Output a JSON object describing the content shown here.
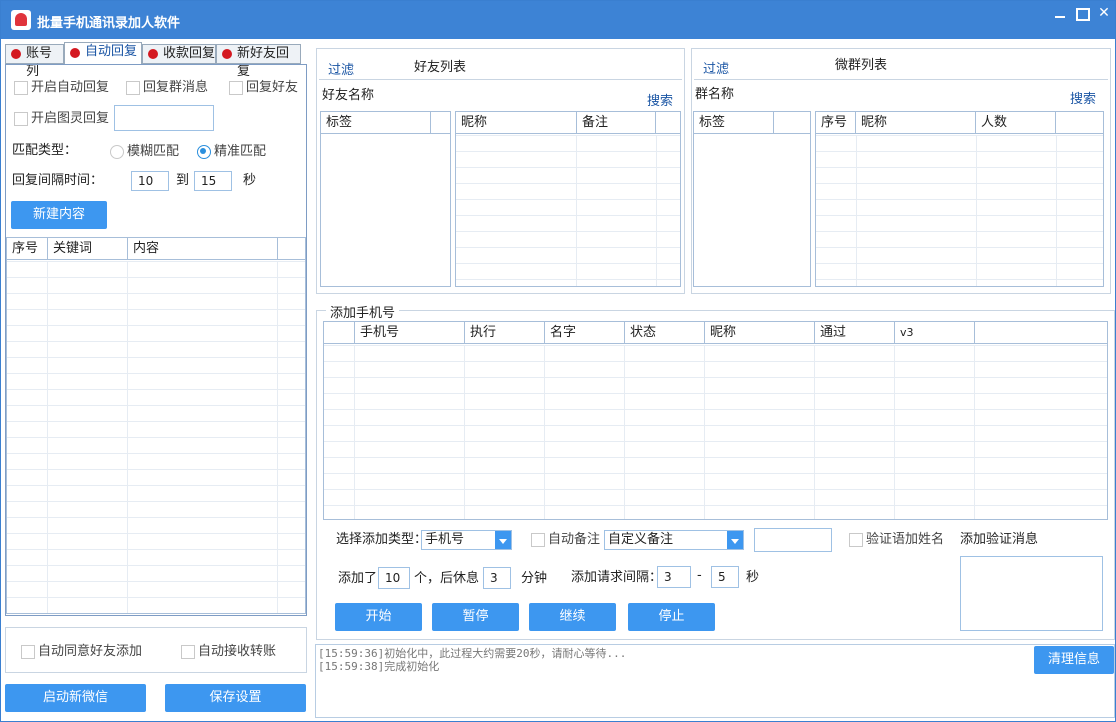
{
  "window": {
    "title": "批量手机通讯录加人软件"
  },
  "tabs": [
    {
      "label": "账号列"
    },
    {
      "label": "自动回复"
    },
    {
      "label": "收款回复"
    },
    {
      "label": "新好友回复"
    }
  ],
  "auto_reply": {
    "enable_auto_reply": "开启自动回复",
    "reply_group_msg": "回复群消息",
    "reply_friend": "回复好友",
    "enable_spirit_reply": "开启图灵回复",
    "spirit_input_value": "",
    "match_type_label": "匹配类型：",
    "fuzzy_match": "模糊匹配",
    "exact_match": "精准匹配",
    "interval_label": "回复间隔时间：",
    "interval_from": "10",
    "to_label": "到",
    "interval_to": "15",
    "sec_label": "秒",
    "new_content_button": "新建内容",
    "table_headers": [
      "序号",
      "关键词",
      "内容"
    ]
  },
  "left_bottom": {
    "auto_accept_friend": "自动同意好友添加",
    "auto_receive_transfer": "自动接收转账",
    "start_new_wechat": "启动新微信",
    "save_settings": "保存设置"
  },
  "friends_panel": {
    "filter_link": "过滤",
    "title": "好友列表",
    "name_label": "好友名称",
    "search_link": "搜索",
    "tag_header": "标签",
    "list_headers": [
      "昵称",
      "备注"
    ]
  },
  "groups_panel": {
    "filter_link": "过滤",
    "title": "微群列表",
    "name_label": "群名称",
    "search_link": "搜索",
    "tag_header": "标签",
    "list_headers": [
      "序号",
      "昵称",
      "人数"
    ]
  },
  "add_phone": {
    "group_title": "添加手机号",
    "table_headers": [
      "手机号",
      "执行",
      "名字",
      "状态",
      "昵称",
      "通过",
      "v3"
    ],
    "select_type_label": "选择添加类型：",
    "select_type_value": "手机号",
    "auto_remark": "自动备注",
    "remark_select_value": "自定义备注",
    "remark_input_value": "",
    "verify_add_name": "验证语加姓名",
    "add_verify_msg": "添加验证消息",
    "added_label": "添加了",
    "added_count": "10",
    "then_rest_label": "个，后休息",
    "rest_minutes": "3",
    "minutes_label": "分钟",
    "request_interval_label": "添加请求间隔：",
    "interval_from": "3",
    "dash": "-",
    "interval_to": "5",
    "sec_label": "秒",
    "start_button": "开始",
    "pause_button": "暂停",
    "continue_button": "继续",
    "stop_button": "停止"
  },
  "log": {
    "lines": [
      "[15:59:36]初始化中，此过程大约需要20秒，请耐心等待...",
      "[15:59:38]完成初始化"
    ],
    "clear_button": "清理信息"
  }
}
